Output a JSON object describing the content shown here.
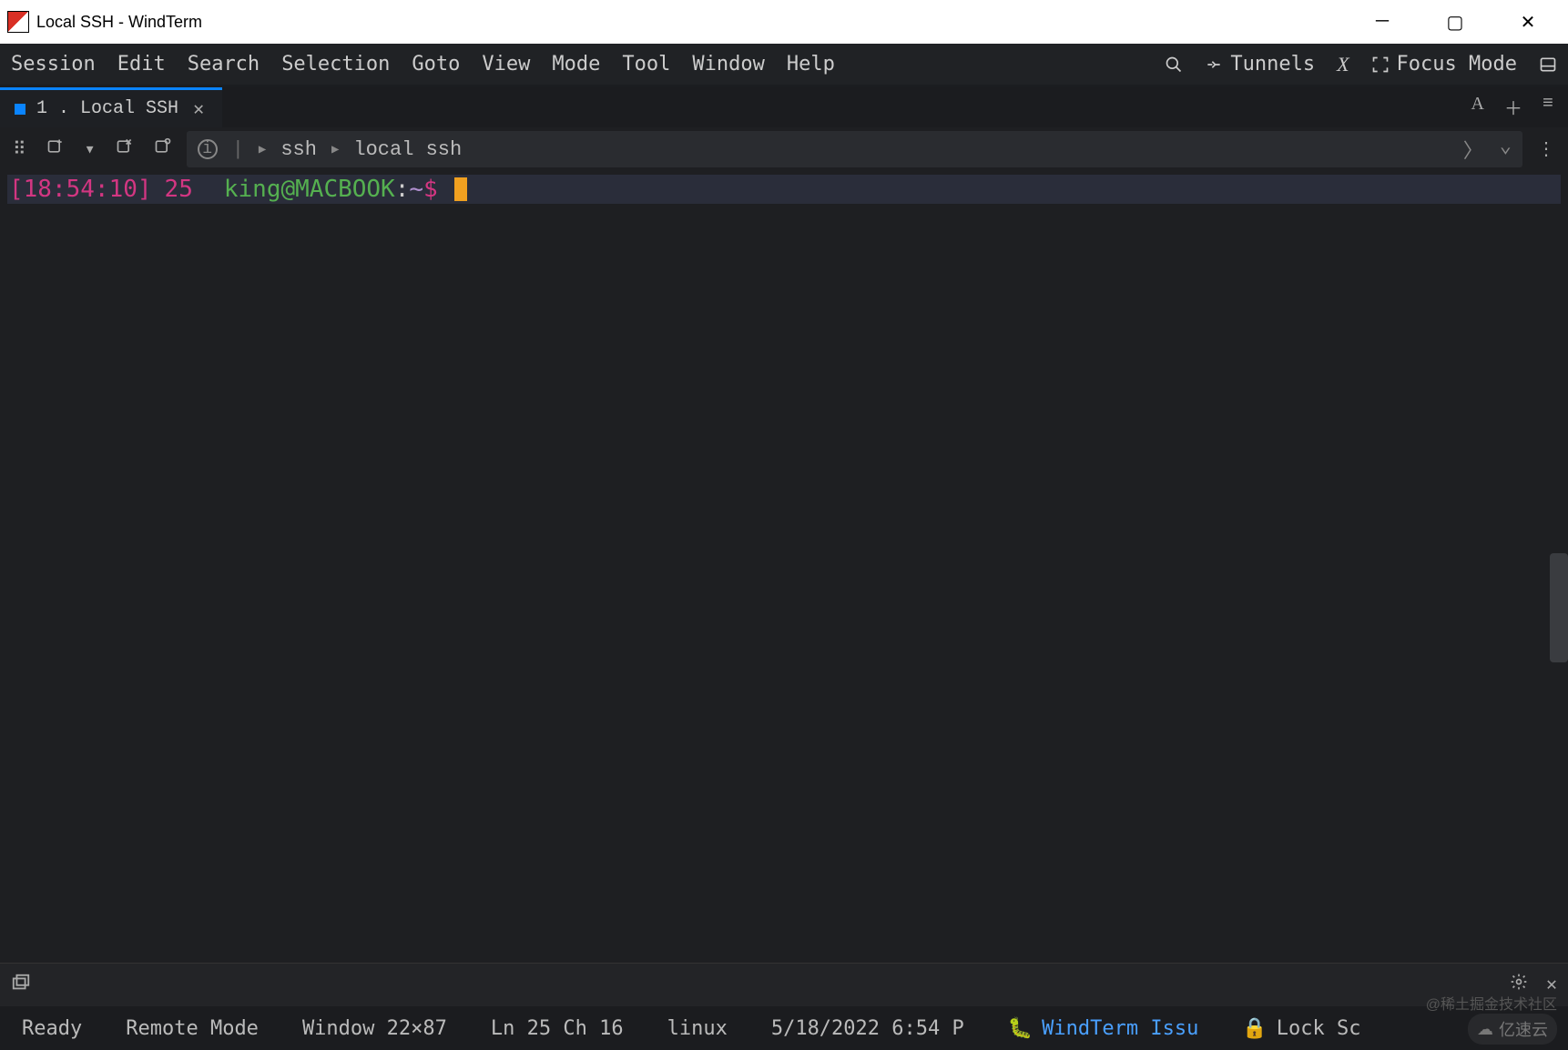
{
  "window": {
    "title": "Local SSH - WindTerm"
  },
  "menubar": {
    "items": [
      "Session",
      "Edit",
      "Search",
      "Selection",
      "Goto",
      "View",
      "Mode",
      "Tool",
      "Window",
      "Help"
    ],
    "right": {
      "tunnels": "Tunnels",
      "x_label": "X",
      "focus_mode": "Focus Mode"
    }
  },
  "tabs": {
    "active": {
      "index": "1",
      "label": "Local SSH"
    }
  },
  "breadcrumb": {
    "items": [
      "ssh",
      "local ssh"
    ]
  },
  "terminal": {
    "timestamp": "[18:54:10]",
    "line_number": "25",
    "user": "king",
    "at": "@",
    "host": "MACBOOK",
    "sep": ":",
    "path": "~",
    "prompt": "$"
  },
  "statusbar": {
    "ready": "Ready",
    "mode": "Remote Mode",
    "window_size": "Window 22×87",
    "cursor": "Ln 25 Ch 16",
    "os": "linux",
    "datetime": "5/18/2022 6:54 P",
    "link_label": "WindTerm Issu",
    "lock_label": "Lock Sc"
  },
  "watermark": {
    "top": "@稀土掘金技术社区",
    "bottom": "亿速云"
  }
}
